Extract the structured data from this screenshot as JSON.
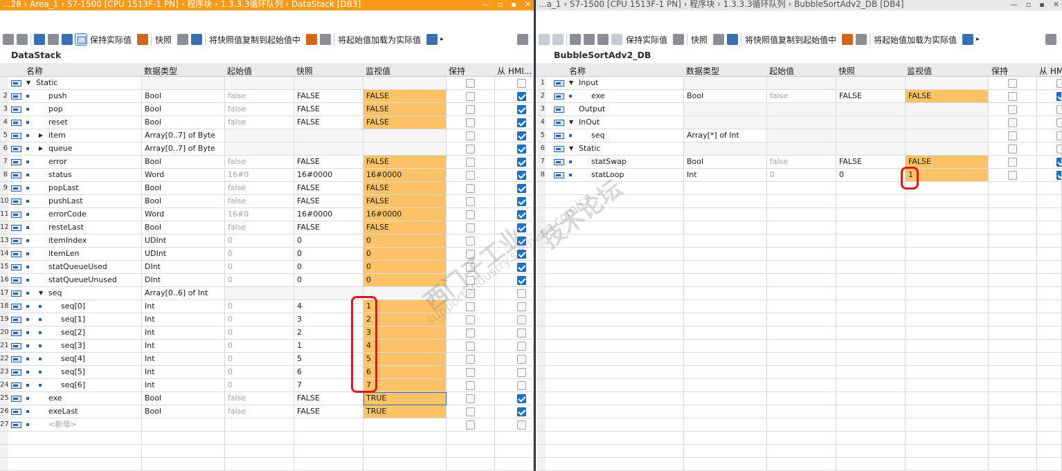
{
  "left": {
    "title": "...28  ›  Area_1  ›  S7-1500 [CPU 1513F-1 PN]  ›  程序块  ›  1.3.3.3循环队列  ›  DataStack [DB3]",
    "window_buttons": [
      "—",
      "▫",
      "▪",
      "✕"
    ],
    "toolbar": {
      "keep_actual": "保持实际值",
      "snapshot": "快照",
      "copy_snapshot": "将快照值复制到起始值中",
      "load_start": "将起始值加载为实际值",
      "more_arrow": "▸"
    },
    "db_name": "DataStack",
    "headers": {
      "name": "名称",
      "type": "数据类型",
      "start": "起始值",
      "snapshot": "快照",
      "monitor": "监视值",
      "retain": "保持",
      "hmi": "从 HMI..."
    },
    "rows": [
      {
        "num": "",
        "tri": "▼",
        "name": "Static",
        "type": "",
        "start": "",
        "snap": "",
        "mon": "",
        "retain": false,
        "hmi": false,
        "level": 0,
        "kind": "section"
      },
      {
        "num": "2",
        "name": "push",
        "type": "Bool",
        "start": "false",
        "snap": "FALSE",
        "mon": "FALSE",
        "retain": false,
        "hmi": true,
        "level": 1
      },
      {
        "num": "3",
        "name": "pop",
        "type": "Bool",
        "start": "false",
        "snap": "FALSE",
        "mon": "FALSE",
        "retain": false,
        "hmi": true,
        "level": 1
      },
      {
        "num": "4",
        "name": "reset",
        "type": "Bool",
        "start": "false",
        "snap": "FALSE",
        "mon": "FALSE",
        "retain": false,
        "hmi": true,
        "level": 1
      },
      {
        "num": "5",
        "tri": "▶",
        "name": "item",
        "type": "Array[0..7] of Byte",
        "start": "",
        "snap": "",
        "mon": "",
        "retain": false,
        "hmi": true,
        "level": 1,
        "kind": "empty"
      },
      {
        "num": "6",
        "tri": "▶",
        "name": "queue",
        "type": "Array[0..7] of Byte",
        "start": "",
        "snap": "",
        "mon": "",
        "retain": false,
        "hmi": true,
        "level": 1,
        "kind": "empty"
      },
      {
        "num": "7",
        "name": "error",
        "type": "Bool",
        "start": "false",
        "snap": "FALSE",
        "mon": "FALSE",
        "retain": false,
        "hmi": true,
        "level": 1
      },
      {
        "num": "8",
        "name": "status",
        "type": "Word",
        "start": "16#0",
        "snap": "16#0000",
        "mon": "16#0000",
        "retain": false,
        "hmi": true,
        "level": 1
      },
      {
        "num": "9",
        "name": "popLast",
        "type": "Bool",
        "start": "false",
        "snap": "FALSE",
        "mon": "FALSE",
        "retain": false,
        "hmi": true,
        "level": 1
      },
      {
        "num": "10",
        "name": "pushLast",
        "type": "Bool",
        "start": "false",
        "snap": "FALSE",
        "mon": "FALSE",
        "retain": false,
        "hmi": true,
        "level": 1
      },
      {
        "num": "11",
        "name": "errorCode",
        "type": "Word",
        "start": "16#0",
        "snap": "16#0000",
        "mon": "16#0000",
        "retain": false,
        "hmi": true,
        "level": 1
      },
      {
        "num": "12",
        "name": "resteLast",
        "type": "Bool",
        "start": "false",
        "snap": "FALSE",
        "mon": "FALSE",
        "retain": false,
        "hmi": true,
        "level": 1
      },
      {
        "num": "13",
        "name": "itemIndex",
        "type": "UDInt",
        "start": "0",
        "snap": "0",
        "mon": "0",
        "retain": false,
        "hmi": true,
        "level": 1
      },
      {
        "num": "14",
        "name": "itemLen",
        "type": "UDInt",
        "start": "0",
        "snap": "0",
        "mon": "0",
        "retain": false,
        "hmi": true,
        "level": 1
      },
      {
        "num": "15",
        "name": "statQueueUsed",
        "type": "DInt",
        "start": "0",
        "snap": "0",
        "mon": "0",
        "retain": false,
        "hmi": true,
        "level": 1
      },
      {
        "num": "16",
        "name": "statQueueUnused",
        "type": "DInt",
        "start": "0",
        "snap": "0",
        "mon": "0",
        "retain": false,
        "hmi": true,
        "level": 1
      },
      {
        "num": "17",
        "tri": "▼",
        "name": "seq",
        "type": "Array[0..6] of Int",
        "start": "",
        "snap": "",
        "mon": "",
        "retain": false,
        "hmi": false,
        "level": 1,
        "kind": "empty"
      },
      {
        "num": "18",
        "name": "seq[0]",
        "type": "Int",
        "start": "0",
        "snap": "4",
        "mon": "1",
        "retain": false,
        "hmi": false,
        "level": 2
      },
      {
        "num": "19",
        "name": "seq[1]",
        "type": "Int",
        "start": "0",
        "snap": "3",
        "mon": "2",
        "retain": false,
        "hmi": false,
        "level": 2
      },
      {
        "num": "20",
        "name": "seq[2]",
        "type": "Int",
        "start": "0",
        "snap": "2",
        "mon": "3",
        "retain": false,
        "hmi": false,
        "level": 2
      },
      {
        "num": "21",
        "name": "seq[3]",
        "type": "Int",
        "start": "0",
        "snap": "1",
        "mon": "4",
        "retain": false,
        "hmi": false,
        "level": 2
      },
      {
        "num": "22",
        "name": "seq[4]",
        "type": "Int",
        "start": "0",
        "snap": "5",
        "mon": "5",
        "retain": false,
        "hmi": false,
        "level": 2
      },
      {
        "num": "23",
        "name": "seq[5]",
        "type": "Int",
        "start": "0",
        "snap": "6",
        "mon": "6",
        "retain": false,
        "hmi": false,
        "level": 2
      },
      {
        "num": "24",
        "name": "seq[6]",
        "type": "Int",
        "start": "0",
        "snap": "7",
        "mon": "7",
        "retain": false,
        "hmi": false,
        "level": 2
      },
      {
        "num": "25",
        "name": "exe",
        "type": "Bool",
        "start": "false",
        "snap": "FALSE",
        "mon": "TRUE",
        "retain": false,
        "hmi": true,
        "level": 1,
        "listbtn": true,
        "selected": true
      },
      {
        "num": "26",
        "name": "exeLast",
        "type": "Bool",
        "start": "false",
        "snap": "FALSE",
        "mon": "TRUE",
        "retain": false,
        "hmi": true,
        "level": 1
      },
      {
        "num": "27",
        "name": "<新增>",
        "type": "",
        "start": "",
        "snap": "",
        "mon": "",
        "retain": false,
        "hmi": false,
        "level": 1,
        "kind": "add"
      }
    ]
  },
  "right": {
    "title": "...a_1  ›  S7-1500 [CPU 1513F-1 PN]  ›  程序块  ›  1.3.3.3循环队列  ›  BubbleSortAdv2_DB [DB4]",
    "window_buttons": [
      "—",
      "▫",
      "▪",
      "✕"
    ],
    "toolbar": {
      "keep_actual": "保持实际值",
      "snapshot": "快照",
      "copy_snapshot": "将快照值复制到起始值中",
      "load_start": "将起始值加载为实际值",
      "more_arrow": "▸"
    },
    "db_name": "BubbleSortAdv2_DB",
    "headers": {
      "name": "名称",
      "type": "数据类型",
      "start": "起始值",
      "snapshot": "快照",
      "monitor": "监视值",
      "retain": "保持",
      "hmi": "从 HMI"
    },
    "rows": [
      {
        "num": "1",
        "tri": "▼",
        "name": "Input",
        "type": "",
        "start": "",
        "snap": "",
        "mon": "",
        "retain": false,
        "hmi": false,
        "level": 0,
        "kind": "section"
      },
      {
        "num": "2",
        "name": "exe",
        "type": "Bool",
        "start": "false",
        "snap": "FALSE",
        "mon": "FALSE",
        "retain": false,
        "hmi": true,
        "level": 1
      },
      {
        "num": "3",
        "name": "Output",
        "type": "",
        "start": "",
        "snap": "",
        "mon": "",
        "retain": false,
        "hmi": false,
        "level": 0,
        "kind": "section",
        "noico": false
      },
      {
        "num": "4",
        "tri": "▼",
        "name": "InOut",
        "type": "",
        "start": "",
        "snap": "",
        "mon": "",
        "retain": false,
        "hmi": false,
        "level": 0,
        "kind": "section"
      },
      {
        "num": "5",
        "name": "seq",
        "type": "Array[*] of Int",
        "start": "",
        "snap": "",
        "mon": "",
        "retain": false,
        "hmi": false,
        "level": 1,
        "kind": "empty"
      },
      {
        "num": "6",
        "tri": "▼",
        "name": "Static",
        "type": "",
        "start": "",
        "snap": "",
        "mon": "",
        "retain": false,
        "hmi": false,
        "level": 0,
        "kind": "section"
      },
      {
        "num": "7",
        "name": "statSwap",
        "type": "Bool",
        "start": "false",
        "snap": "FALSE",
        "mon": "FALSE",
        "retain": false,
        "hmi": true,
        "level": 1
      },
      {
        "num": "8",
        "name": "statLoop",
        "type": "Int",
        "start": "0",
        "snap": "0",
        "mon": "1",
        "retain": false,
        "hmi": true,
        "level": 1,
        "hover": true
      }
    ]
  },
  "watermark": {
    "line1": "西门子工业",
    "line2": "技术论坛",
    "url": "support.industry.siemens.com/cs"
  },
  "colors": {
    "orange_title": "#f79a1a",
    "monitor_cell": "#ffc367",
    "checkbox_on": "#1d74c5",
    "annotation_red": "#e0141e"
  }
}
